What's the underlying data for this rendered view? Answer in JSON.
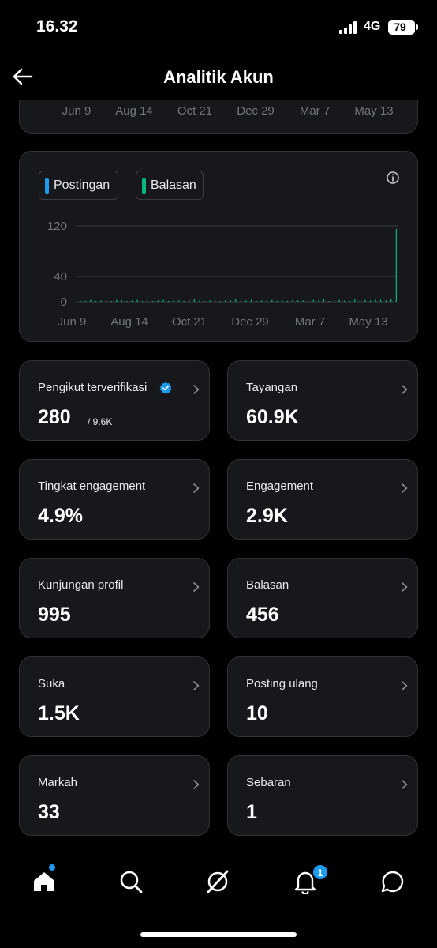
{
  "status_bar": {
    "time": "16.32",
    "network": "4G",
    "battery": "79"
  },
  "header": {
    "title": "Analitik Akun"
  },
  "top_chart": {
    "x_ticks": [
      "Jun 9",
      "Aug 14",
      "Oct 21",
      "Dec 29",
      "Mar 7",
      "May 13"
    ]
  },
  "chart_data": {
    "type": "bar",
    "title": "",
    "legend": [
      "Postingan",
      "Balasan"
    ],
    "legend_colors": [
      "#1d9bf0",
      "#00ba7c"
    ],
    "xlabel": "",
    "ylabel": "",
    "x_ticks": [
      "Jun 9",
      "Aug 14",
      "Oct 21",
      "Dec 29",
      "Mar 7",
      "May 13"
    ],
    "y_ticks": [
      0,
      40,
      120
    ],
    "ylim": [
      0,
      120
    ],
    "grid": true,
    "series": [
      {
        "name": "Postingan",
        "values": [
          0,
          0,
          0,
          0,
          0,
          0,
          0,
          0,
          0,
          0,
          0,
          0,
          0,
          0,
          0,
          0,
          0,
          0,
          0,
          0,
          0,
          0,
          0,
          0,
          0,
          0,
          0,
          0,
          0,
          0,
          0,
          0,
          0,
          0,
          0,
          0,
          0,
          0,
          0,
          0,
          0,
          0,
          0,
          0,
          0,
          0,
          0,
          0,
          0,
          0,
          0,
          0,
          0,
          0,
          0,
          0,
          0,
          0,
          0,
          0,
          0,
          0
        ]
      },
      {
        "name": "Balasan",
        "values": [
          2,
          1,
          3,
          1,
          2,
          2,
          1,
          3,
          2,
          1,
          2,
          3,
          1,
          2,
          1,
          2,
          3,
          1,
          2,
          2,
          1,
          3,
          5,
          2,
          1,
          2,
          3,
          1,
          2,
          2,
          4,
          1,
          2,
          3,
          1,
          2,
          2,
          3,
          1,
          2,
          1,
          3,
          2,
          2,
          1,
          3,
          2,
          4,
          1,
          2,
          3,
          2,
          1,
          4,
          2,
          3,
          2,
          4,
          3,
          2,
          5,
          115
        ]
      }
    ]
  },
  "stats": [
    {
      "label": "Pengikut terverifikasi",
      "value": "280",
      "sub": "/ 9.6K",
      "verified": true
    },
    {
      "label": "Tayangan",
      "value": "60.9K"
    },
    {
      "label": "Tingkat engagement",
      "value": "4.9%"
    },
    {
      "label": "Engagement",
      "value": "2.9K"
    },
    {
      "label": "Kunjungan profil",
      "value": "995"
    },
    {
      "label": "Balasan",
      "value": "456"
    },
    {
      "label": "Suka",
      "value": "1.5K"
    },
    {
      "label": "Posting ulang",
      "value": "10"
    },
    {
      "label": "Markah",
      "value": "33"
    },
    {
      "label": "Sebaran",
      "value": "1"
    }
  ],
  "bottom_nav": {
    "items": [
      "home-icon",
      "search-icon",
      "grok-icon",
      "bell-icon",
      "messages-icon"
    ],
    "notification_count": "1"
  },
  "colors": {
    "accent": "#1d9bf0",
    "replies": "#00ba7c",
    "card_bg": "#16181c",
    "border": "#2f3336"
  }
}
